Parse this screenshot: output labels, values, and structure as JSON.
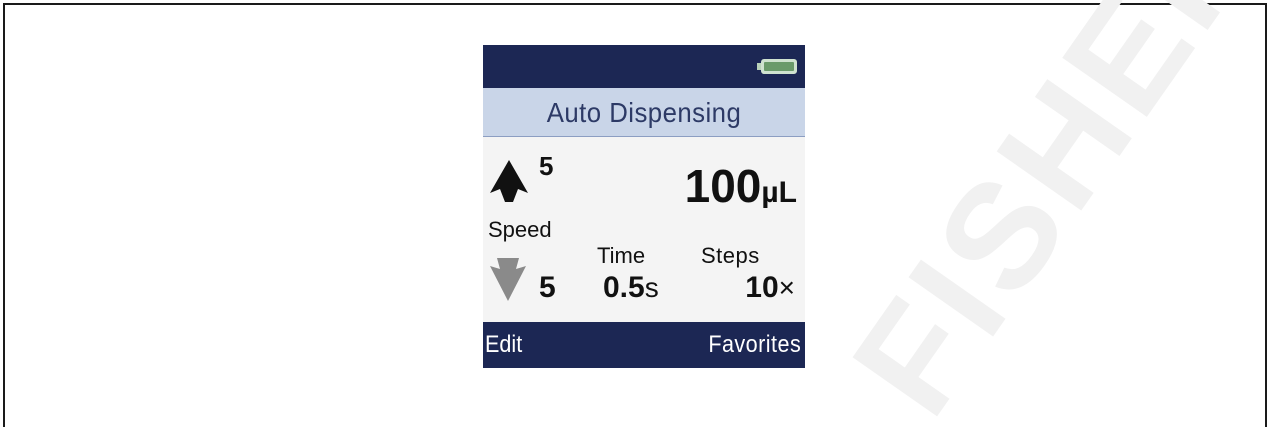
{
  "screen": {
    "title": "Auto Dispensing",
    "battery_icon": "battery-full-icon",
    "colors": {
      "header_bg": "#1c2754",
      "title_bg": "#c9d5e8",
      "title_text": "#2d3a66",
      "battery": "#6a9a6a",
      "arrow_up": "#111111",
      "arrow_down": "#8a8a8a"
    }
  },
  "speed": {
    "label": "Speed",
    "aspirate_icon": "arrow-up-icon",
    "aspirate_value": "5",
    "dispense_icon": "arrow-down-icon",
    "dispense_value": "5"
  },
  "volume": {
    "value": "100",
    "unit": "µL"
  },
  "time": {
    "label": "Time",
    "value": "0.5",
    "unit": "s"
  },
  "steps": {
    "label": "Steps",
    "value": "10",
    "unit": "×"
  },
  "softkeys": {
    "left": "Edit",
    "right": "Favorites"
  },
  "watermark": {
    "text": "FISHER SCIENTIFIC"
  }
}
